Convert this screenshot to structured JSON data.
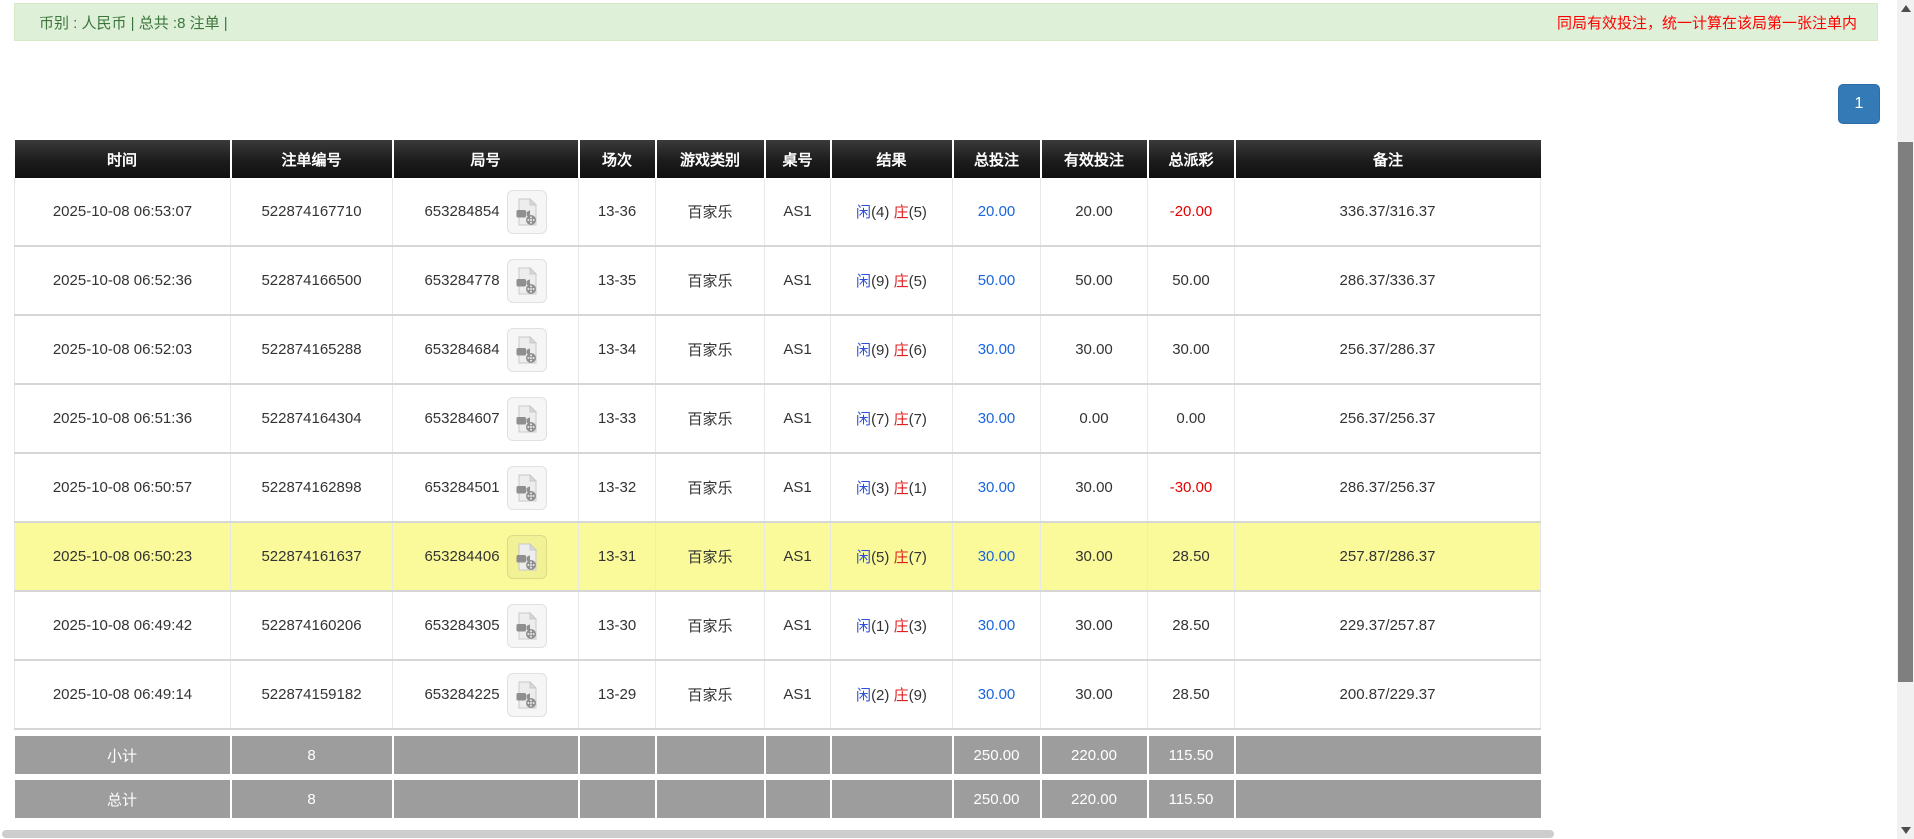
{
  "topbar": {
    "summary": "币别 : 人民币 | 总共 :8 注单 |",
    "notice": "同局有效投注，统一计算在该局第一张注单内"
  },
  "pagination": {
    "page": "1"
  },
  "table": {
    "columns": [
      "时间",
      "注单编号",
      "局号",
      "场次",
      "游戏类别",
      "桌号",
      "结果",
      "总投注",
      "有效投注",
      "总派彩",
      "备注"
    ],
    "rows": [
      {
        "time": "2025-10-08 06:53:07",
        "bet_id": "522874167710",
        "round_id": "653284854",
        "session": "13-36",
        "game": "百家乐",
        "table_no": "AS1",
        "player_label": "闲",
        "player_score": "(4)",
        "banker_label": "庄",
        "banker_score": "(5)",
        "total_bet": "20.00",
        "valid_bet": "20.00",
        "payout": "-20.00",
        "remark": "336.37/316.37",
        "highlight": false
      },
      {
        "time": "2025-10-08 06:52:36",
        "bet_id": "522874166500",
        "round_id": "653284778",
        "session": "13-35",
        "game": "百家乐",
        "table_no": "AS1",
        "player_label": "闲",
        "player_score": "(9)",
        "banker_label": "庄",
        "banker_score": "(5)",
        "total_bet": "50.00",
        "valid_bet": "50.00",
        "payout": "50.00",
        "remark": "286.37/336.37",
        "highlight": false
      },
      {
        "time": "2025-10-08 06:52:03",
        "bet_id": "522874165288",
        "round_id": "653284684",
        "session": "13-34",
        "game": "百家乐",
        "table_no": "AS1",
        "player_label": "闲",
        "player_score": "(9)",
        "banker_label": "庄",
        "banker_score": "(6)",
        "total_bet": "30.00",
        "valid_bet": "30.00",
        "payout": "30.00",
        "remark": "256.37/286.37",
        "highlight": false
      },
      {
        "time": "2025-10-08 06:51:36",
        "bet_id": "522874164304",
        "round_id": "653284607",
        "session": "13-33",
        "game": "百家乐",
        "table_no": "AS1",
        "player_label": "闲",
        "player_score": "(7)",
        "banker_label": "庄",
        "banker_score": "(7)",
        "total_bet": "30.00",
        "valid_bet": "0.00",
        "payout": "0.00",
        "remark": "256.37/256.37",
        "highlight": false
      },
      {
        "time": "2025-10-08 06:50:57",
        "bet_id": "522874162898",
        "round_id": "653284501",
        "session": "13-32",
        "game": "百家乐",
        "table_no": "AS1",
        "player_label": "闲",
        "player_score": "(3)",
        "banker_label": "庄",
        "banker_score": "(1)",
        "total_bet": "30.00",
        "valid_bet": "30.00",
        "payout": "-30.00",
        "remark": "286.37/256.37",
        "highlight": false
      },
      {
        "time": "2025-10-08 06:50:23",
        "bet_id": "522874161637",
        "round_id": "653284406",
        "session": "13-31",
        "game": "百家乐",
        "table_no": "AS1",
        "player_label": "闲",
        "player_score": "(5)",
        "banker_label": "庄",
        "banker_score": "(7)",
        "total_bet": "30.00",
        "valid_bet": "30.00",
        "payout": "28.50",
        "remark": "257.87/286.37",
        "highlight": true
      },
      {
        "time": "2025-10-08 06:49:42",
        "bet_id": "522874160206",
        "round_id": "653284305",
        "session": "13-30",
        "game": "百家乐",
        "table_no": "AS1",
        "player_label": "闲",
        "player_score": "(1)",
        "banker_label": "庄",
        "banker_score": "(3)",
        "total_bet": "30.00",
        "valid_bet": "30.00",
        "payout": "28.50",
        "remark": "229.37/257.87",
        "highlight": false
      },
      {
        "time": "2025-10-08 06:49:14",
        "bet_id": "522874159182",
        "round_id": "653284225",
        "session": "13-29",
        "game": "百家乐",
        "table_no": "AS1",
        "player_label": "闲",
        "player_score": "(2)",
        "banker_label": "庄",
        "banker_score": "(9)",
        "total_bet": "30.00",
        "valid_bet": "30.00",
        "payout": "28.50",
        "remark": "200.87/229.37",
        "highlight": false
      }
    ],
    "subtotal": {
      "label": "小计",
      "count": "8",
      "total_bet": "250.00",
      "valid_bet": "220.00",
      "payout": "115.50"
    },
    "total": {
      "label": "总计",
      "count": "8",
      "total_bet": "250.00",
      "valid_bet": "220.00",
      "payout": "115.50"
    }
  },
  "icons": {
    "round_video": "video-file-icon",
    "scroll_up": "triangle-up",
    "scroll_down": "triangle-down"
  },
  "colors": {
    "topbar_bg": "#dff0d8",
    "topbar_text": "#3c763d",
    "notice_red": "#ff0000",
    "header_bg": "#1c1c1c",
    "accent_blue": "#1a66e0",
    "banker_red": "#e02020",
    "player_blue": "#2b50d9",
    "negative_red": "#e60000",
    "highlight_yellow": "#fafa9b",
    "footer_gray": "#9d9d9d",
    "page_button_blue": "#337ab7"
  }
}
